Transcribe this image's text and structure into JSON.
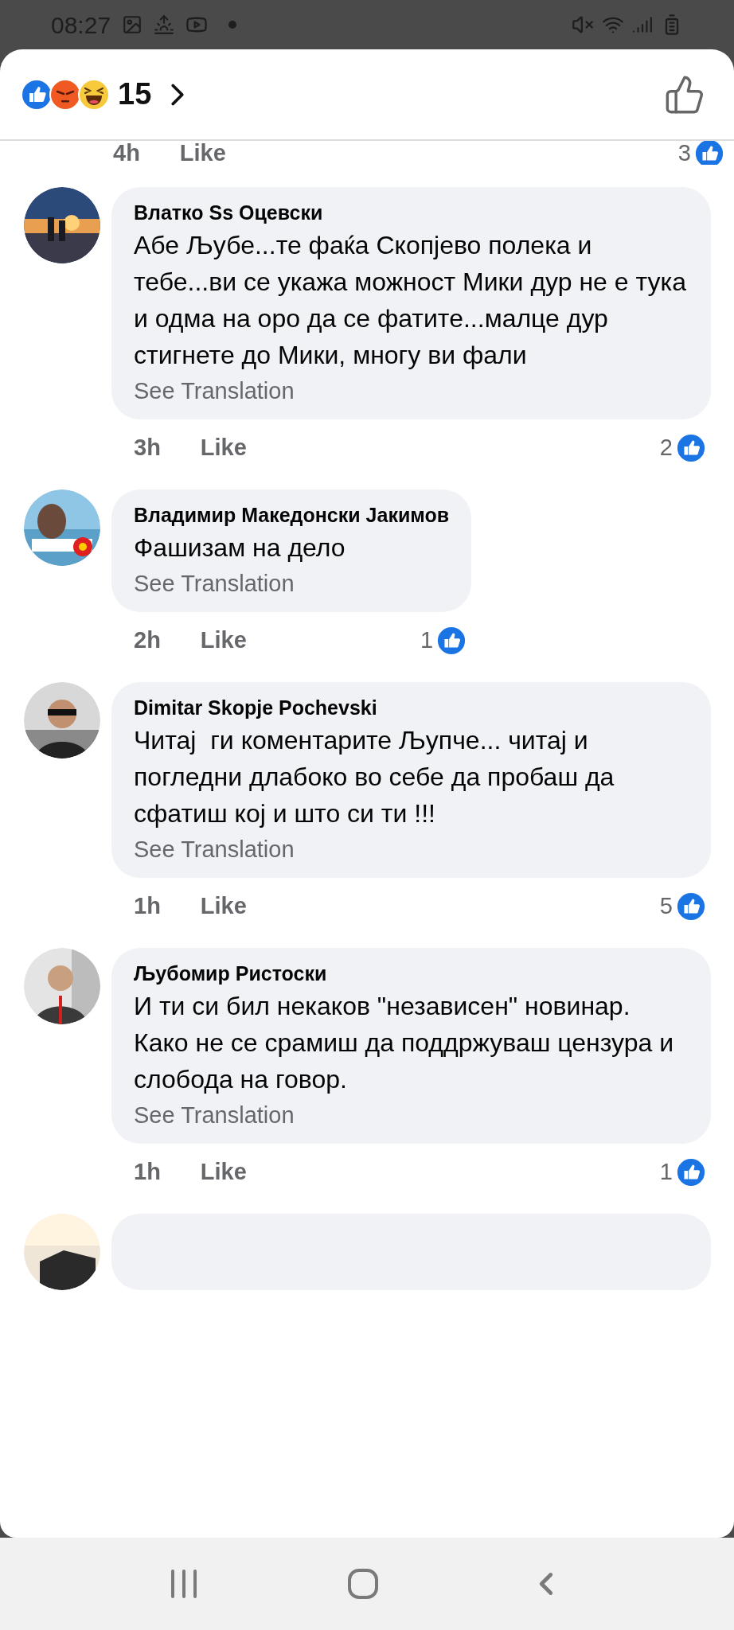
{
  "status_bar": {
    "time": "08:27"
  },
  "header": {
    "reaction_count": "15"
  },
  "partial_row": {
    "time": "4h",
    "like": "Like",
    "reaction_count": "3"
  },
  "comments": [
    {
      "author": "Влатко Ss Оцевски",
      "text": "Абе Љубе...те фаќа Скопјево полека и  тебе...ви се укажа можност Мики дур не е тука и одма на оро да се фатите...малце дур стигнете до Мики, многу ви фали",
      "translation_link": "See Translation",
      "time": "3h",
      "like": "Like",
      "reaction_count": "2"
    },
    {
      "author": "Владимир Македонски Јакимов",
      "text": "Фашизам на дело",
      "translation_link": "See Translation",
      "time": "2h",
      "like": "Like",
      "reaction_count": "1"
    },
    {
      "author": "Dimitar Skopje Pochevski",
      "text": "Читај  ги коментарите Љупче... читај и погледни длабоко во себе да пробаш да сфатиш кој и што си ти !!!",
      "translation_link": "See Translation",
      "time": "1h",
      "like": "Like",
      "reaction_count": "5"
    },
    {
      "author": "Љубомир Ристоски",
      "text": "И ти си бил некаков \"независен\" новинар. Како не се срамиш да поддржуваш цензура и слобода на говор.",
      "translation_link": "See Translation",
      "time": "1h",
      "like": "Like",
      "reaction_count": "1"
    }
  ]
}
